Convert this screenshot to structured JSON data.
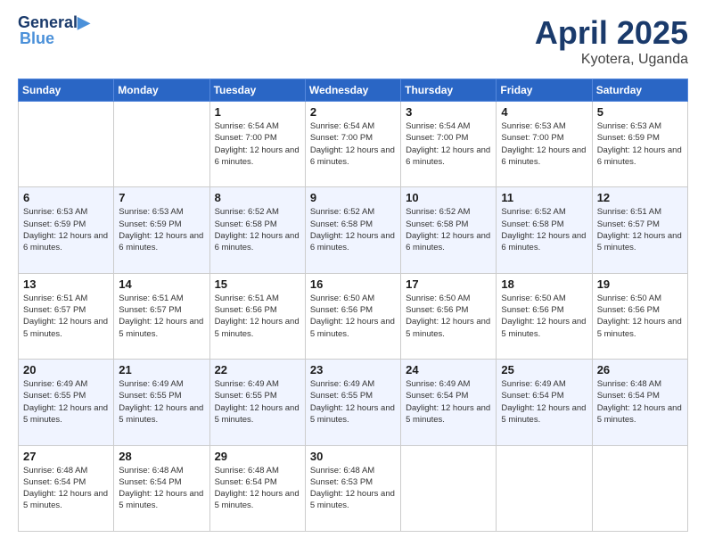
{
  "header": {
    "logo_line1": "General",
    "logo_line2": "Blue",
    "month": "April 2025",
    "location": "Kyotera, Uganda"
  },
  "weekdays": [
    "Sunday",
    "Monday",
    "Tuesday",
    "Wednesday",
    "Thursday",
    "Friday",
    "Saturday"
  ],
  "weeks": [
    [
      {
        "day": "",
        "sunrise": "",
        "sunset": "",
        "daylight": ""
      },
      {
        "day": "",
        "sunrise": "",
        "sunset": "",
        "daylight": ""
      },
      {
        "day": "1",
        "sunrise": "Sunrise: 6:54 AM",
        "sunset": "Sunset: 7:00 PM",
        "daylight": "Daylight: 12 hours and 6 minutes."
      },
      {
        "day": "2",
        "sunrise": "Sunrise: 6:54 AM",
        "sunset": "Sunset: 7:00 PM",
        "daylight": "Daylight: 12 hours and 6 minutes."
      },
      {
        "day": "3",
        "sunrise": "Sunrise: 6:54 AM",
        "sunset": "Sunset: 7:00 PM",
        "daylight": "Daylight: 12 hours and 6 minutes."
      },
      {
        "day": "4",
        "sunrise": "Sunrise: 6:53 AM",
        "sunset": "Sunset: 7:00 PM",
        "daylight": "Daylight: 12 hours and 6 minutes."
      },
      {
        "day": "5",
        "sunrise": "Sunrise: 6:53 AM",
        "sunset": "Sunset: 6:59 PM",
        "daylight": "Daylight: 12 hours and 6 minutes."
      }
    ],
    [
      {
        "day": "6",
        "sunrise": "Sunrise: 6:53 AM",
        "sunset": "Sunset: 6:59 PM",
        "daylight": "Daylight: 12 hours and 6 minutes."
      },
      {
        "day": "7",
        "sunrise": "Sunrise: 6:53 AM",
        "sunset": "Sunset: 6:59 PM",
        "daylight": "Daylight: 12 hours and 6 minutes."
      },
      {
        "day": "8",
        "sunrise": "Sunrise: 6:52 AM",
        "sunset": "Sunset: 6:58 PM",
        "daylight": "Daylight: 12 hours and 6 minutes."
      },
      {
        "day": "9",
        "sunrise": "Sunrise: 6:52 AM",
        "sunset": "Sunset: 6:58 PM",
        "daylight": "Daylight: 12 hours and 6 minutes."
      },
      {
        "day": "10",
        "sunrise": "Sunrise: 6:52 AM",
        "sunset": "Sunset: 6:58 PM",
        "daylight": "Daylight: 12 hours and 6 minutes."
      },
      {
        "day": "11",
        "sunrise": "Sunrise: 6:52 AM",
        "sunset": "Sunset: 6:58 PM",
        "daylight": "Daylight: 12 hours and 6 minutes."
      },
      {
        "day": "12",
        "sunrise": "Sunrise: 6:51 AM",
        "sunset": "Sunset: 6:57 PM",
        "daylight": "Daylight: 12 hours and 5 minutes."
      }
    ],
    [
      {
        "day": "13",
        "sunrise": "Sunrise: 6:51 AM",
        "sunset": "Sunset: 6:57 PM",
        "daylight": "Daylight: 12 hours and 5 minutes."
      },
      {
        "day": "14",
        "sunrise": "Sunrise: 6:51 AM",
        "sunset": "Sunset: 6:57 PM",
        "daylight": "Daylight: 12 hours and 5 minutes."
      },
      {
        "day": "15",
        "sunrise": "Sunrise: 6:51 AM",
        "sunset": "Sunset: 6:56 PM",
        "daylight": "Daylight: 12 hours and 5 minutes."
      },
      {
        "day": "16",
        "sunrise": "Sunrise: 6:50 AM",
        "sunset": "Sunset: 6:56 PM",
        "daylight": "Daylight: 12 hours and 5 minutes."
      },
      {
        "day": "17",
        "sunrise": "Sunrise: 6:50 AM",
        "sunset": "Sunset: 6:56 PM",
        "daylight": "Daylight: 12 hours and 5 minutes."
      },
      {
        "day": "18",
        "sunrise": "Sunrise: 6:50 AM",
        "sunset": "Sunset: 6:56 PM",
        "daylight": "Daylight: 12 hours and 5 minutes."
      },
      {
        "day": "19",
        "sunrise": "Sunrise: 6:50 AM",
        "sunset": "Sunset: 6:56 PM",
        "daylight": "Daylight: 12 hours and 5 minutes."
      }
    ],
    [
      {
        "day": "20",
        "sunrise": "Sunrise: 6:49 AM",
        "sunset": "Sunset: 6:55 PM",
        "daylight": "Daylight: 12 hours and 5 minutes."
      },
      {
        "day": "21",
        "sunrise": "Sunrise: 6:49 AM",
        "sunset": "Sunset: 6:55 PM",
        "daylight": "Daylight: 12 hours and 5 minutes."
      },
      {
        "day": "22",
        "sunrise": "Sunrise: 6:49 AM",
        "sunset": "Sunset: 6:55 PM",
        "daylight": "Daylight: 12 hours and 5 minutes."
      },
      {
        "day": "23",
        "sunrise": "Sunrise: 6:49 AM",
        "sunset": "Sunset: 6:55 PM",
        "daylight": "Daylight: 12 hours and 5 minutes."
      },
      {
        "day": "24",
        "sunrise": "Sunrise: 6:49 AM",
        "sunset": "Sunset: 6:54 PM",
        "daylight": "Daylight: 12 hours and 5 minutes."
      },
      {
        "day": "25",
        "sunrise": "Sunrise: 6:49 AM",
        "sunset": "Sunset: 6:54 PM",
        "daylight": "Daylight: 12 hours and 5 minutes."
      },
      {
        "day": "26",
        "sunrise": "Sunrise: 6:48 AM",
        "sunset": "Sunset: 6:54 PM",
        "daylight": "Daylight: 12 hours and 5 minutes."
      }
    ],
    [
      {
        "day": "27",
        "sunrise": "Sunrise: 6:48 AM",
        "sunset": "Sunset: 6:54 PM",
        "daylight": "Daylight: 12 hours and 5 minutes."
      },
      {
        "day": "28",
        "sunrise": "Sunrise: 6:48 AM",
        "sunset": "Sunset: 6:54 PM",
        "daylight": "Daylight: 12 hours and 5 minutes."
      },
      {
        "day": "29",
        "sunrise": "Sunrise: 6:48 AM",
        "sunset": "Sunset: 6:54 PM",
        "daylight": "Daylight: 12 hours and 5 minutes."
      },
      {
        "day": "30",
        "sunrise": "Sunrise: 6:48 AM",
        "sunset": "Sunset: 6:53 PM",
        "daylight": "Daylight: 12 hours and 5 minutes."
      },
      {
        "day": "",
        "sunrise": "",
        "sunset": "",
        "daylight": ""
      },
      {
        "day": "",
        "sunrise": "",
        "sunset": "",
        "daylight": ""
      },
      {
        "day": "",
        "sunrise": "",
        "sunset": "",
        "daylight": ""
      }
    ]
  ]
}
